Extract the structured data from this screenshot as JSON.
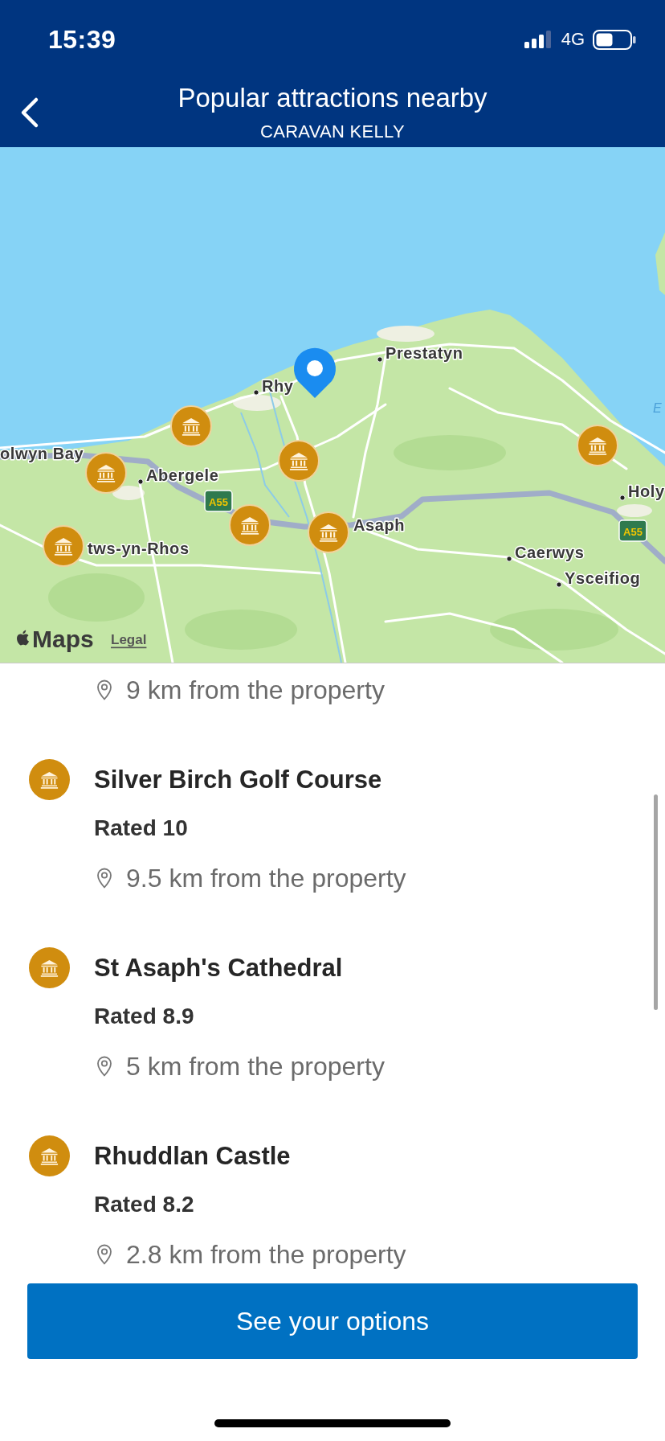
{
  "status_bar": {
    "time": "15:39",
    "network": "4G"
  },
  "header": {
    "title": "Popular attractions nearby",
    "subtitle": "CARAVAN KELLY"
  },
  "map": {
    "labels": [
      {
        "text": "Prestatyn",
        "kind": "town"
      },
      {
        "text": "Rhy",
        "kind": "town"
      },
      {
        "text": "E",
        "kind": "water"
      },
      {
        "text": "olwyn Bay",
        "kind": "place"
      },
      {
        "text": "Abergele",
        "kind": "town"
      },
      {
        "text": "Holy",
        "kind": "town"
      },
      {
        "text": "Asaph",
        "kind": "place"
      },
      {
        "text": "tws-yn-Rhos",
        "kind": "place"
      },
      {
        "text": "Caerwys",
        "kind": "town"
      },
      {
        "text": "Ysceifiog",
        "kind": "town"
      }
    ],
    "road_signs": [
      "A55",
      "A55"
    ],
    "attribution": "Maps",
    "legal": "Legal"
  },
  "attractions": [
    {
      "distance": "9 km from the property"
    },
    {
      "name": "Silver Birch Golf Course",
      "rating": "Rated 10",
      "distance": "9.5 km from the property"
    },
    {
      "name": "St Asaph's Cathedral",
      "rating": "Rated 8.9",
      "distance": "5 km from the property"
    },
    {
      "name": "Rhuddlan Castle",
      "rating": "Rated 8.2",
      "distance": "2.8 km from the property"
    }
  ],
  "button": {
    "label": "See your options"
  }
}
